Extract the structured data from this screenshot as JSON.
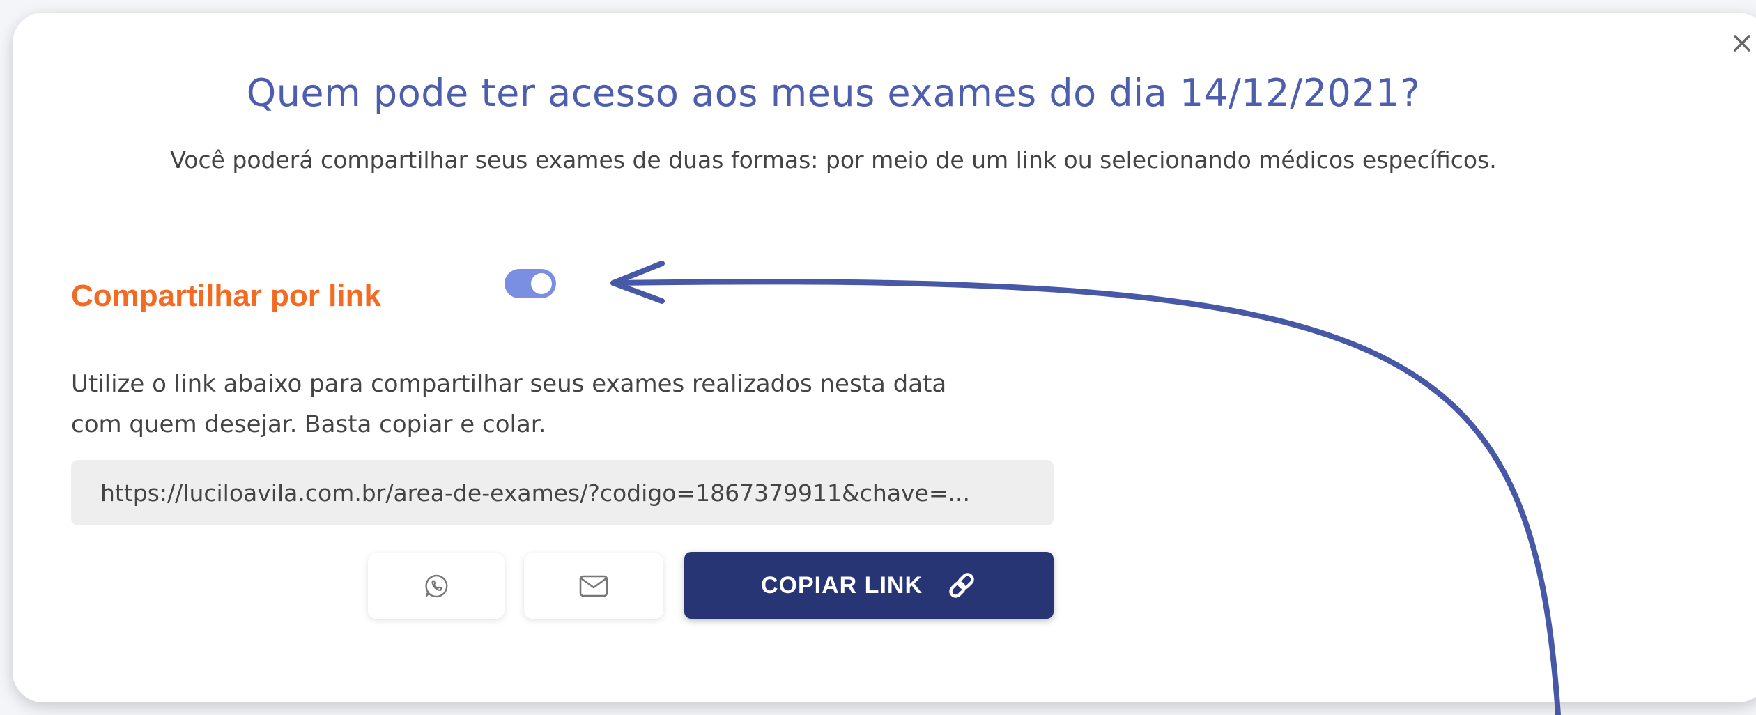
{
  "modal": {
    "title": "Quem pode ter acesso aos meus exames do dia 14/12/2021?",
    "subtitle": "Você poderá compartilhar seus exames de duas formas: por meio de um link ou selecionando médicos específicos.",
    "close_icon": "close-icon"
  },
  "share_link": {
    "title": "Compartilhar por link",
    "toggle_on": true,
    "toggle_color": "#7b8fe2",
    "description_line1": "Utilize o link abaixo para compartilhar seus exames realizados nesta data",
    "description_line2": "com quem desejar. Basta copiar e colar.",
    "link_value": "https://luciloavila.com.br/area-de-exames/?codigo=1867379911&chave=...",
    "whatsapp_icon": "whatsapp-icon",
    "email_icon": "mail-icon",
    "copy_label": "COPIAR LINK",
    "copy_icon": "link-icon",
    "copy_button_color": "#273574",
    "accent_color": "#f36a22"
  },
  "annotation": {
    "arrow_color": "#4658a6"
  }
}
